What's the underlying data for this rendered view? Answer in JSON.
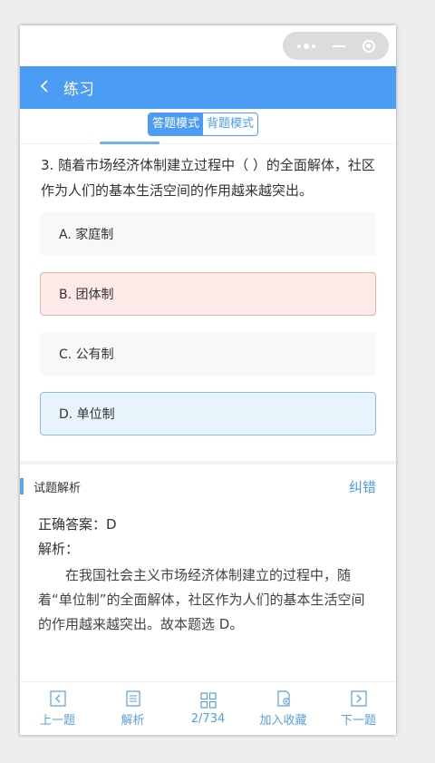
{
  "nav": {
    "back_icon": "chevron-left-icon",
    "title": "练习"
  },
  "modes": {
    "active": "答题模式",
    "inactive": "背题模式"
  },
  "question": {
    "text": "3. 随着市场经济体制建立过程中（ ）的全面解体，社区作为人们的基本生活空间的作用越来越突出。"
  },
  "options": [
    {
      "label": "A. 家庭制",
      "state": "normal"
    },
    {
      "label": "B. 团体制",
      "state": "wrong"
    },
    {
      "label": "C. 公有制",
      "state": "normal"
    },
    {
      "label": "D. 单位制",
      "state": "correct"
    }
  ],
  "analysis": {
    "title": "试题解析",
    "report_label": "纠错",
    "answer": "正确答案：D",
    "label": "解析：",
    "text": "在我国社会主义市场经济体制建立的过程中，随着“单位制”的全面解体，社区作为人们的基本生活空间的作用越来越突出。故本题选 D。"
  },
  "toolbar": {
    "prev": "上一题",
    "explain": "解析",
    "progress": "2/734",
    "favorite": "加入收藏",
    "next": "下一题"
  },
  "colors": {
    "primary": "#4b9cf5",
    "wrong_bg": "#fde9e7",
    "correct_bg": "#e8f4fc"
  }
}
